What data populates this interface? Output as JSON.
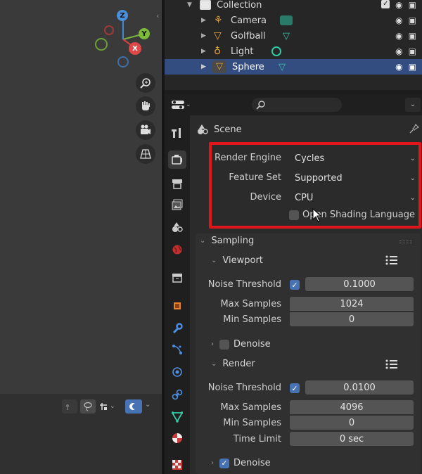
{
  "outliner": {
    "collection": "Collection",
    "items": [
      {
        "label": "Camera"
      },
      {
        "label": "Golfball"
      },
      {
        "label": "Light"
      },
      {
        "label": "Sphere"
      }
    ]
  },
  "gizmo": {
    "z": "Z",
    "y": "Y",
    "x": "X"
  },
  "props": {
    "context": "Scene",
    "render_engine_label": "Render Engine",
    "render_engine": "Cycles",
    "feature_set_label": "Feature Set",
    "feature_set": "Supported",
    "device_label": "Device",
    "device": "CPU",
    "osl_label": "Open Shading Language",
    "sampling": {
      "title": "Sampling",
      "viewport": {
        "title": "Viewport",
        "noise_threshold_label": "Noise Threshold",
        "noise_threshold": "0.1000",
        "max_samples_label": "Max Samples",
        "max_samples": "1024",
        "min_samples_label": "Min Samples",
        "min_samples": "0",
        "denoise_label": "Denoise"
      },
      "render": {
        "title": "Render",
        "noise_threshold_label": "Noise Threshold",
        "noise_threshold": "0.0100",
        "max_samples_label": "Max Samples",
        "max_samples": "4096",
        "min_samples_label": "Min Samples",
        "min_samples": "0",
        "time_limit_label": "Time Limit",
        "time_limit": "0 sec",
        "denoise_label": "Denoise"
      }
    }
  },
  "colors": {
    "highlight": "#e0161b",
    "accent": "#4772b3"
  }
}
